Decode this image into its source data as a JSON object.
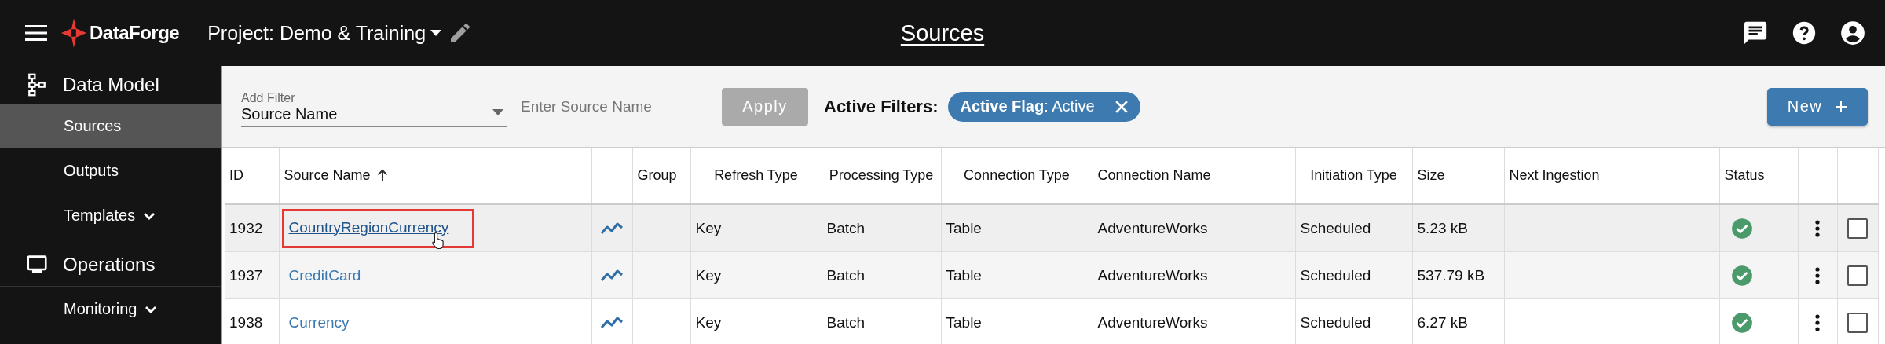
{
  "header": {
    "app_name": "DataForge",
    "project": "Project: Demo & Training",
    "page_title": "Sources"
  },
  "sidebar": {
    "sections": [
      {
        "label": "Data Model",
        "kind": "model",
        "items": [
          {
            "label": "Sources",
            "selected": true,
            "expandable": false
          },
          {
            "label": "Outputs",
            "selected": false,
            "expandable": false
          },
          {
            "label": "Templates",
            "selected": false,
            "expandable": true
          }
        ]
      },
      {
        "label": "Operations",
        "kind": "monitor",
        "items": [
          {
            "label": "Monitoring",
            "selected": false,
            "expandable": true
          }
        ]
      }
    ]
  },
  "filters": {
    "add_filter_label": "Add Filter",
    "add_filter_value": "Source Name",
    "name_placeholder": "Enter Source Name",
    "apply": "Apply",
    "apply_disabled": true,
    "active_filters_label": "Active Filters:",
    "chips": [
      {
        "text": "**Active Flag**: Active"
      }
    ],
    "new_button": "New"
  },
  "table": {
    "columns": [
      {
        "label": "ID",
        "sorted": false
      },
      {
        "label": "Source Name",
        "sorted": true
      },
      {
        "label": "Group",
        "sorted": false
      },
      {
        "label": "Refresh Type",
        "sorted": false
      },
      {
        "label": "Processing Type",
        "sorted": false
      },
      {
        "label": "Connection Type",
        "sorted": false
      },
      {
        "label": "Connection Name",
        "sorted": false
      },
      {
        "label": "Initiation Type",
        "sorted": false
      },
      {
        "label": "Size",
        "sorted": false
      },
      {
        "label": "Next Ingestion",
        "sorted": false
      },
      {
        "label": "Status",
        "sorted": false
      }
    ],
    "rows": [
      {
        "id": "1932",
        "name": "CountryRegionCurrency",
        "hovered": true,
        "highlighted": true,
        "refresh": "Key",
        "processing": "Batch",
        "connection_type": "Table",
        "connection_name": "AdventureWorks",
        "initiation": "Scheduled",
        "size": "5.23 kB",
        "status_ok": true,
        "checked": false
      },
      {
        "id": "1937",
        "name": "CreditCard",
        "hovered": false,
        "highlighted": false,
        "refresh": "Key",
        "processing": "Batch",
        "connection_type": "Table",
        "connection_name": "AdventureWorks",
        "initiation": "Scheduled",
        "size": "537.79 kB",
        "status_ok": true,
        "checked": false
      },
      {
        "id": "1938",
        "name": "Currency",
        "hovered": false,
        "highlighted": false,
        "refresh": "Key",
        "processing": "Batch",
        "connection_type": "Table",
        "connection_name": "AdventureWorks",
        "initiation": "Scheduled",
        "size": "6.27 kB",
        "status_ok": true,
        "checked": false
      }
    ]
  }
}
